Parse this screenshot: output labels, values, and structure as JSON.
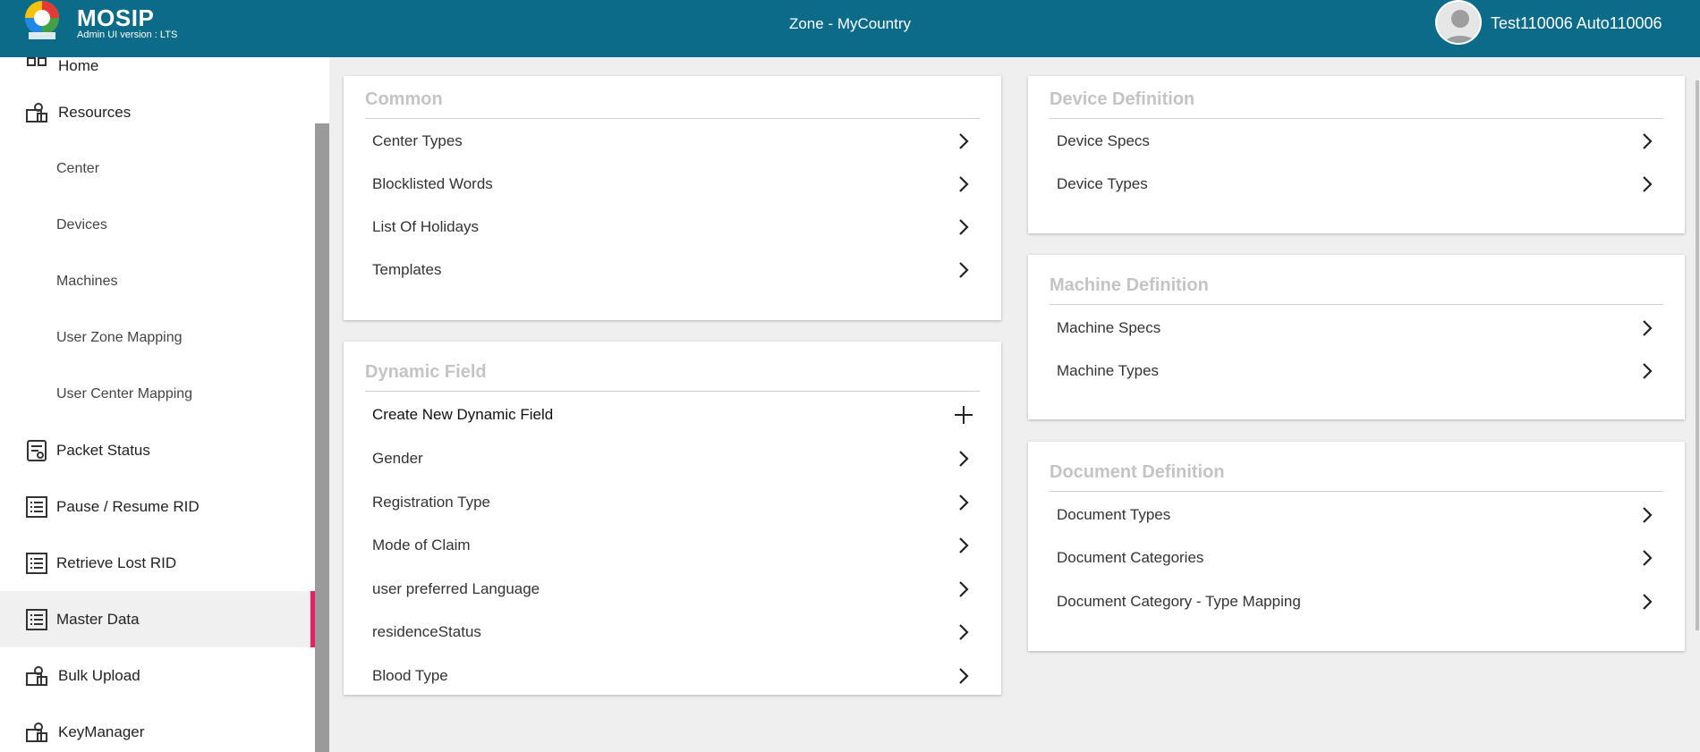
{
  "header": {
    "brand": "MOSIP",
    "version": "Admin UI version : LTS",
    "zone": "Zone - MyCountry",
    "user": "Test110006 Auto110006",
    "color": "#0c6b88"
  },
  "sidebar": {
    "accent": "#e91e63",
    "items": [
      {
        "label": "Home",
        "icon": "home-icon"
      },
      {
        "label": "Resources",
        "icon": "resources-icon"
      },
      {
        "label": "Center"
      },
      {
        "label": "Devices"
      },
      {
        "label": "Machines"
      },
      {
        "label": "User Zone Mapping"
      },
      {
        "label": "User Center Mapping"
      },
      {
        "label": "Packet Status",
        "icon": "packet-status-icon"
      },
      {
        "label": "Pause / Resume RID",
        "icon": "list-icon"
      },
      {
        "label": "Retrieve Lost RID",
        "icon": "list-icon"
      },
      {
        "label": "Master Data",
        "icon": "list-icon",
        "active": true
      },
      {
        "label": "Bulk Upload",
        "icon": "upload-icon"
      },
      {
        "label": "KeyManager",
        "icon": "key-manager-icon"
      }
    ]
  },
  "cards": {
    "common": {
      "title": "Common",
      "rows": [
        "Center Types",
        "Blocklisted Words",
        "List Of Holidays",
        "Templates"
      ]
    },
    "dynamic": {
      "title": "Dynamic Field",
      "create": "Create New Dynamic Field",
      "rows": [
        "Gender",
        "Registration Type",
        "Mode of Claim",
        "user preferred Language",
        "residenceStatus",
        "Blood Type"
      ]
    },
    "device": {
      "title": "Device Definition",
      "rows": [
        "Device Specs",
        "Device Types"
      ]
    },
    "machine": {
      "title": "Machine Definition",
      "rows": [
        "Machine Specs",
        "Machine Types"
      ]
    },
    "document": {
      "title": "Document Definition",
      "rows": [
        "Document Types",
        "Document Categories",
        "Document Category - Type Mapping"
      ]
    }
  }
}
